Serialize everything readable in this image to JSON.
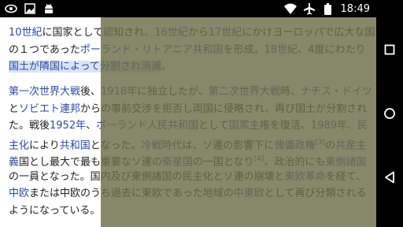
{
  "status_bar": {
    "time": "18:49",
    "left_icons": [
      "eye-icon",
      "image-icon",
      "android-icon"
    ],
    "right_icons": [
      "wifi-icon",
      "airplane-icon",
      "battery-icon"
    ]
  },
  "article": {
    "para1": [
      [
        {
          "t": "10世紀",
          "link": true
        },
        {
          "t": "に国家として認知され、"
        },
        {
          "t": "16世紀",
          "link": true
        },
        {
          "t": "から"
        },
        {
          "t": "17世紀",
          "link": true
        },
        {
          "t": "にかけヨーロッパで広大な国"
        }
      ],
      [
        {
          "t": "の１つであった"
        },
        {
          "t": "ポーランド・リトアニア共和国",
          "link": true
        },
        {
          "t": "を形成。"
        },
        {
          "t": "18世紀",
          "link": true
        },
        {
          "t": "、4度にわたり"
        }
      ],
      [
        {
          "t": "国土が隣国によって分割され消滅",
          "link": true,
          "hl": true
        },
        {
          "t": "。"
        }
      ]
    ],
    "para2": [
      [
        {
          "t": "第一次世界大戦",
          "link": true
        },
        {
          "t": "後、"
        },
        {
          "t": "1918年",
          "link": true
        },
        {
          "t": "に独立したが、"
        },
        {
          "t": "第二次世界大戦",
          "link": true
        },
        {
          "t": "時、"
        },
        {
          "t": "ナチス・ドイツ",
          "link": true
        }
      ],
      [
        {
          "t": "と"
        },
        {
          "t": "ソビエト連邦",
          "link": true
        },
        {
          "t": "からの事前交渉を拒否し両国に侵略され、再び国土が分割され"
        }
      ],
      [
        {
          "t": "た。戦後"
        },
        {
          "t": "1952年",
          "link": true
        },
        {
          "t": "、"
        },
        {
          "t": "ポーランド人民共和国",
          "link": true
        },
        {
          "t": "として"
        },
        {
          "t": "国家主権",
          "link": true
        },
        {
          "t": "を復活、"
        },
        {
          "t": "1989年",
          "link": true
        },
        {
          "t": "、"
        },
        {
          "t": "民",
          "link": true
        }
      ],
      [
        {
          "t": "主化",
          "link": true
        },
        {
          "t": "により"
        },
        {
          "t": "共和国",
          "link": true
        },
        {
          "t": "となった。"
        },
        {
          "t": "冷戦時代",
          "link": true
        },
        {
          "t": "は、ソ連の影響下に"
        },
        {
          "t": "傀儡政権",
          "link": true
        },
        {
          "t": "[3]",
          "sup": true
        },
        {
          "t": "の"
        },
        {
          "t": "共産主",
          "link": true
        }
      ],
      [
        {
          "t": "義",
          "link": true
        },
        {
          "t": "国とし最大で最も重要なソ連の"
        },
        {
          "t": "衛星国",
          "link": true
        },
        {
          "t": "の一国となり"
        },
        {
          "t": "[4]",
          "sup": true
        },
        {
          "t": "、政治的にも"
        },
        {
          "t": "東側諸国",
          "link": true
        }
      ],
      [
        {
          "t": "の一員となった。国内及び東側諸国の民主化とソ連の崩壊と"
        },
        {
          "t": "東欧革命",
          "link": true
        },
        {
          "t": "を経て、"
        }
      ],
      [
        {
          "t": "中欧",
          "link": true
        },
        {
          "t": "または中欧のうち過去に東欧であった地域の"
        },
        {
          "t": "中東欧",
          "link": true
        },
        {
          "t": "として再び分類される"
        }
      ],
      [
        {
          "t": "ようになっている。"
        }
      ]
    ]
  },
  "nav_bar": {
    "buttons": [
      "recents-button",
      "home-button",
      "back-button"
    ]
  }
}
